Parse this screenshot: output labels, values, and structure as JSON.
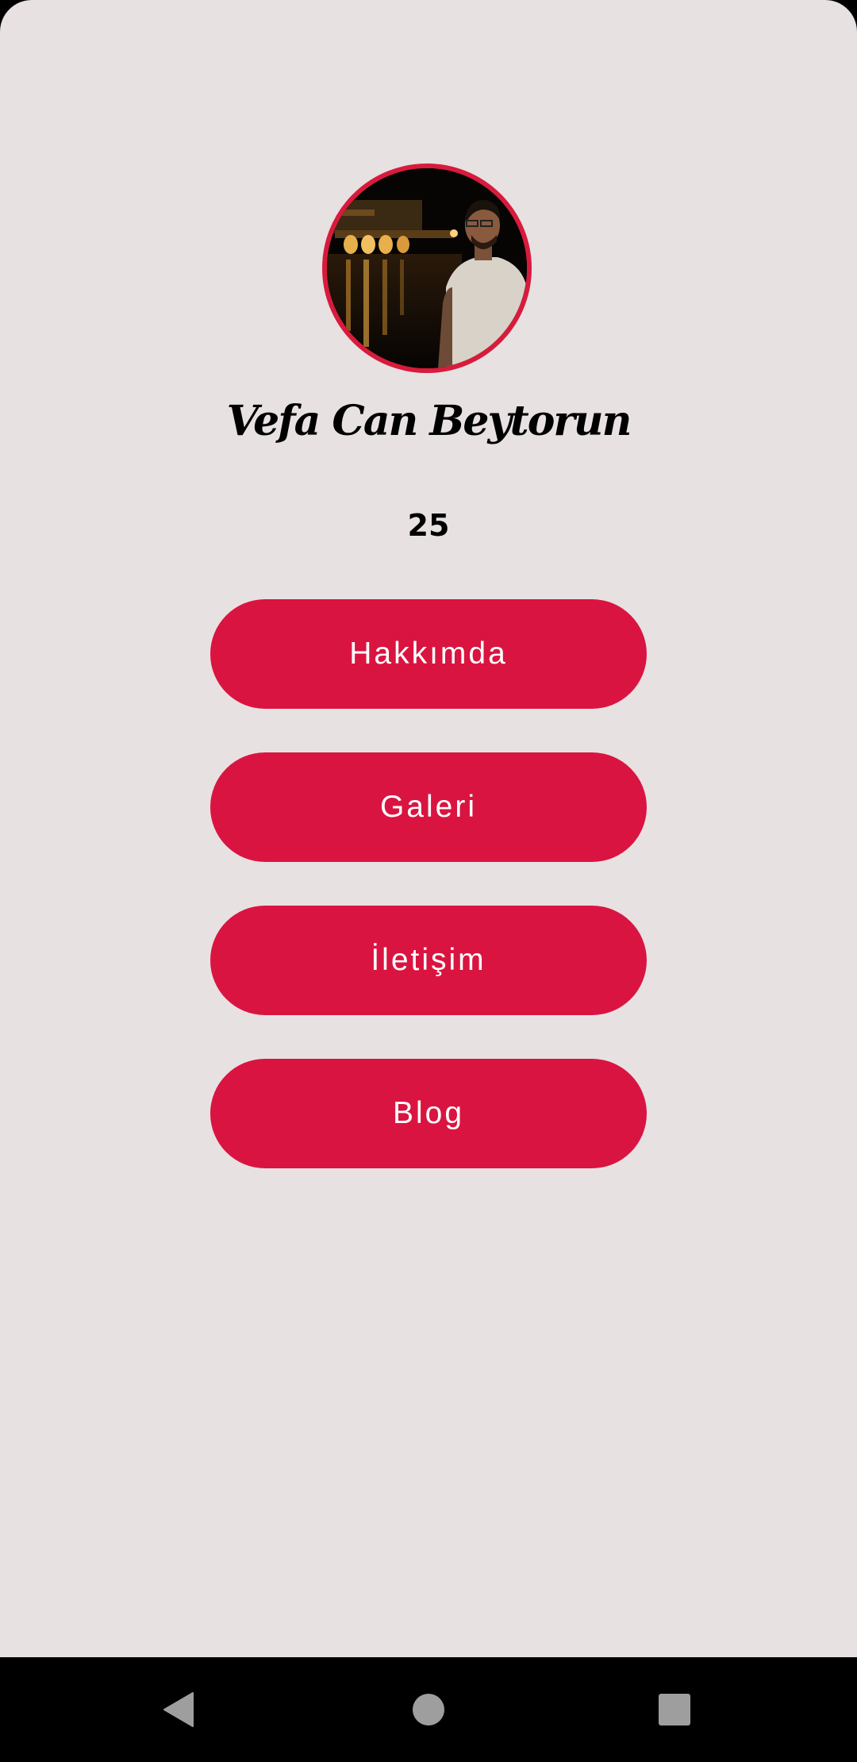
{
  "profile": {
    "name": "Vefa Can Beytorun",
    "age": "25",
    "avatar_icon": "profile-photo"
  },
  "menu": {
    "items": [
      {
        "label": "Hakkımda"
      },
      {
        "label": "Galeri"
      },
      {
        "label": "İletişim"
      },
      {
        "label": "Blog"
      }
    ]
  },
  "navbar": {
    "back_icon": "back-triangle-icon",
    "home_icon": "home-circle-icon",
    "recents_icon": "recents-square-icon"
  },
  "colors": {
    "background": "#e7e1e2",
    "accent": "#da1440",
    "button_text": "#ffffff",
    "navbar": "#000000",
    "nav_icons": "#9e9e9e"
  }
}
